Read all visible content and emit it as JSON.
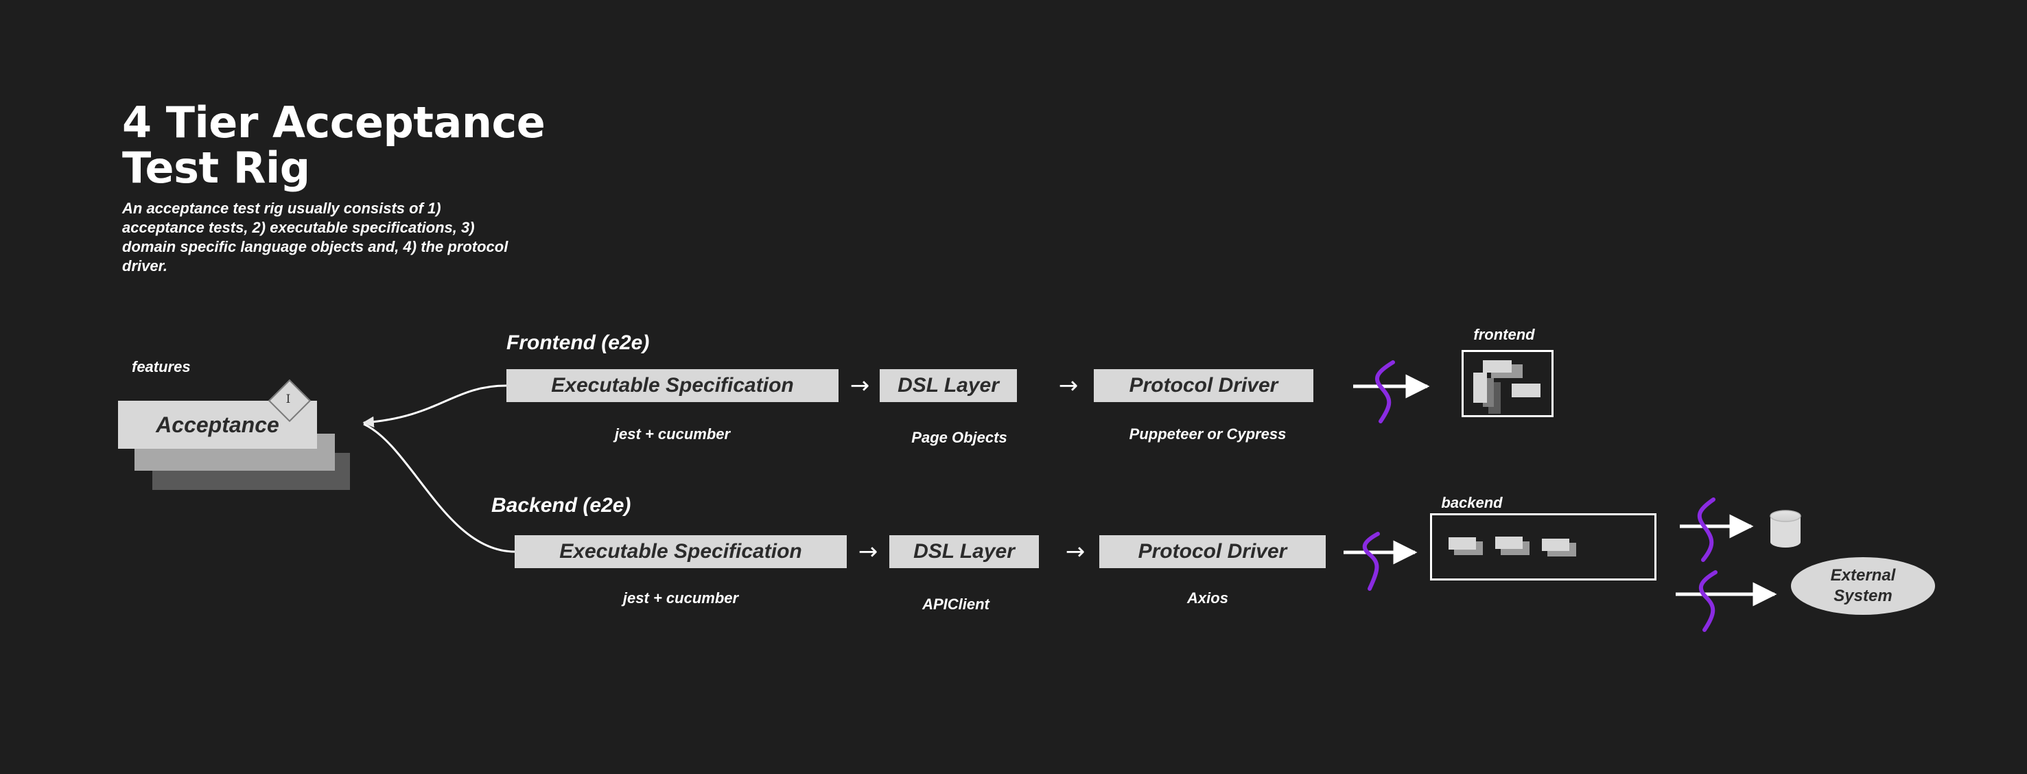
{
  "header": {
    "title": "4 Tier Acceptance\nTest Rig",
    "subtitle": "An acceptance test rig usually consists of 1) acceptance tests, 2) executable specifications, 3) domain specific language objects and, 4) the protocol driver."
  },
  "acceptance": {
    "features_label": "features",
    "card_label": "Acceptance",
    "badge_letter": "I"
  },
  "rows": [
    {
      "title": "Frontend (e2e)",
      "boxes": [
        {
          "label": "Executable Specification",
          "caption": "jest + cucumber"
        },
        {
          "label": "DSL Layer",
          "caption": "Page Objects"
        },
        {
          "label": "Protocol Driver",
          "caption": "Puppeteer or Cypress"
        }
      ],
      "arrow_glyph": "→",
      "target_label": "frontend"
    },
    {
      "title": "Backend (e2e)",
      "boxes": [
        {
          "label": "Executable Specification",
          "caption": "jest + cucumber"
        },
        {
          "label": "DSL Layer",
          "caption": "APIClient"
        },
        {
          "label": "Protocol Driver",
          "caption": "Axios"
        }
      ],
      "arrow_glyph": "→",
      "target_label": "backend"
    }
  ],
  "external": {
    "database_name": "database-cylinder",
    "system_label": "External\nSystem"
  },
  "colors": {
    "background": "#1e1e1e",
    "box_fill": "#d8d8d8",
    "box_text": "#2b2b2b",
    "stack_mid": "#a8a8a8",
    "stack_back": "#595959",
    "boundary_purple": "#8a2be2",
    "connector_white": "#ffffff"
  }
}
